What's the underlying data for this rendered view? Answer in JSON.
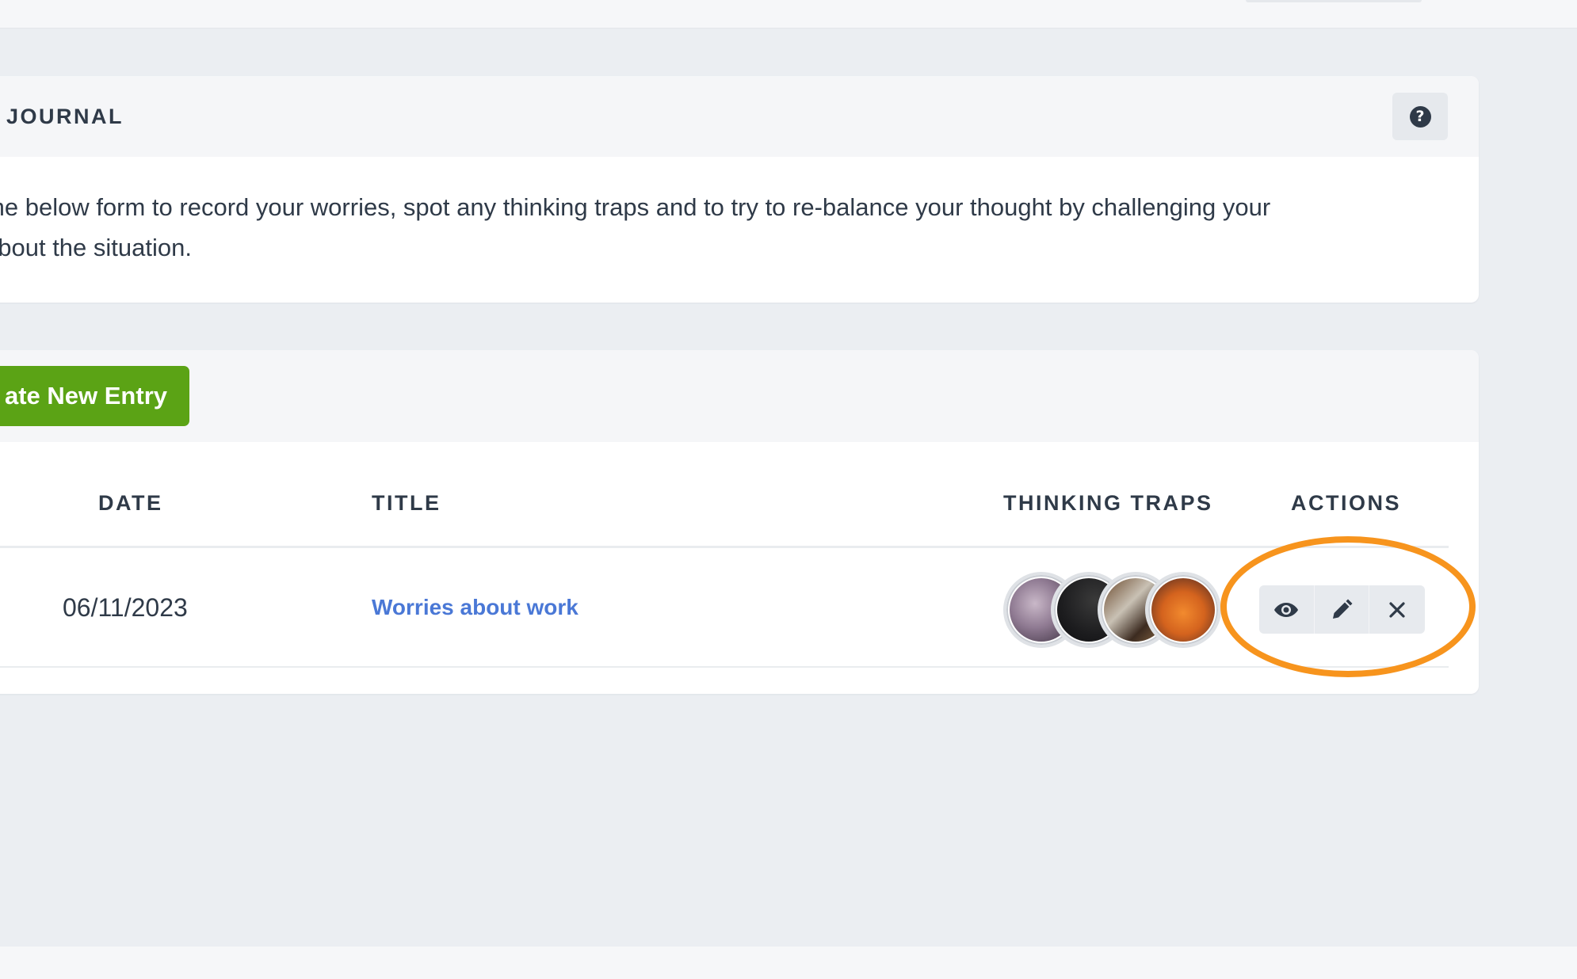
{
  "journal": {
    "title": "JOURNAL",
    "help_icon": "question-circle-icon",
    "intro_line_1": "the below form to record your worries, spot any thinking traps and to try to re-balance your thought by challenging your",
    "intro_line_2": "about the situation."
  },
  "entries": {
    "create_label": "ate New Entry",
    "columns": [
      "DATE",
      "TITLE",
      "THINKING TRAPS",
      "ACTIONS"
    ],
    "rows": [
      {
        "date": "06/11/2023",
        "title": "Worries about work",
        "thinking_traps": [
          "trap-image-1",
          "trap-image-2",
          "trap-image-3",
          "trap-image-4"
        ],
        "actions": [
          "eye-icon",
          "pencil-icon",
          "close-icon"
        ]
      }
    ]
  },
  "colors": {
    "page_background": "#ebeef2",
    "card_background": "#ffffff",
    "card_header_background": "#f5f6f8",
    "primary_text": "#2f3a48",
    "create_button": "#5ba315",
    "link": "#4a78d6",
    "action_button": "#e7eaee",
    "highlight_ring": "#f7941d"
  }
}
